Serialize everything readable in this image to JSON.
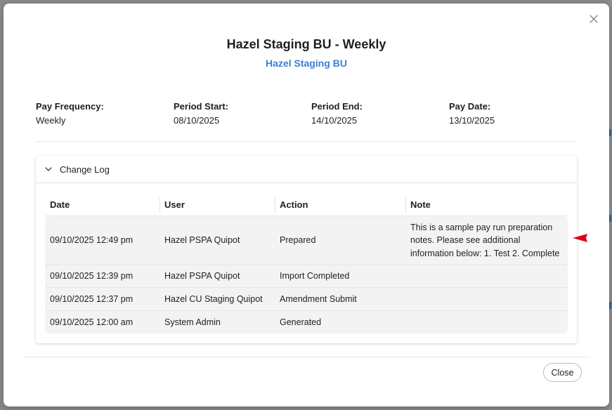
{
  "modal": {
    "title": "Hazel Staging BU - Weekly",
    "subtitle": "Hazel Staging BU",
    "close_button_label": "Close"
  },
  "info": [
    {
      "label": "Pay Frequency:",
      "value": "Weekly"
    },
    {
      "label": "Period Start:",
      "value": "08/10/2025"
    },
    {
      "label": "Period End:",
      "value": "14/10/2025"
    },
    {
      "label": "Pay Date:",
      "value": "13/10/2025"
    }
  ],
  "change_log": {
    "title": "Change Log",
    "expanded": true,
    "columns": [
      "Date",
      "User",
      "Action",
      "Note"
    ],
    "rows": [
      {
        "date": "09/10/2025 12:49 pm",
        "user": "Hazel PSPA Quipot",
        "action": "Prepared",
        "note": "This is a sample pay run preparation notes. Please see additional information below: 1. Test 2. Complete"
      },
      {
        "date": "09/10/2025 12:39 pm",
        "user": "Hazel PSPA Quipot",
        "action": "Import Completed",
        "note": ""
      },
      {
        "date": "09/10/2025 12:37 pm",
        "user": "Hazel CU Staging Quipot",
        "action": "Amendment Submit",
        "note": ""
      },
      {
        "date": "09/10/2025 12:00 am",
        "user": "System Admin",
        "action": "Generated",
        "note": ""
      }
    ]
  },
  "icons": {
    "close": "close-icon",
    "collapse": "chevron-down-icon",
    "pointer": "red-arrow-icon"
  },
  "colors": {
    "accent": "#3a7fd6",
    "pointer": "#e0001a"
  }
}
